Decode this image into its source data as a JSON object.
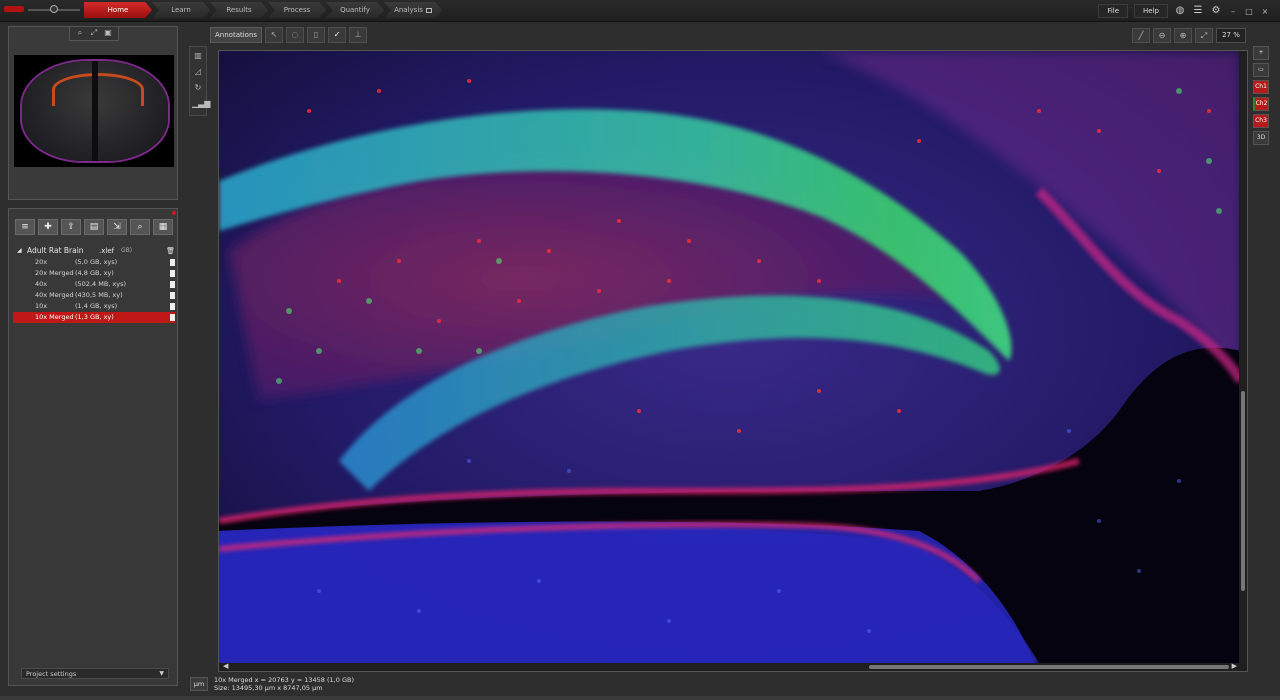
{
  "topbar": {
    "tabs": [
      {
        "label": "Home",
        "active": true
      },
      {
        "label": "Learn"
      },
      {
        "label": "Results"
      },
      {
        "label": "Process"
      },
      {
        "label": "Quantify"
      },
      {
        "label": "Analysis",
        "locked": true
      }
    ],
    "file_label": "File",
    "help_label": "Help",
    "icons": [
      "globe-icon",
      "list-icon",
      "gear-icon"
    ],
    "window_controls": [
      "–",
      "□",
      "×"
    ]
  },
  "navigator": {
    "tools": [
      "zoom-region-icon",
      "fit-icon",
      "overview-toggle-icon"
    ]
  },
  "project": {
    "tool_icons": [
      "add-icon",
      "new-file-icon",
      "import-icon",
      "save-icon",
      "export-icon",
      "search-icon",
      "grid-icon"
    ],
    "root": {
      "name": "Adult Rat Brain",
      "ext": ".xlef",
      "size": "GB)"
    },
    "items": [
      {
        "name": "20x",
        "detail": "(5,0 GB, xys)",
        "selected": false
      },
      {
        "name": "20x Merged",
        "detail": "(4,8 GB, xy)",
        "selected": false
      },
      {
        "name": "40x",
        "detail": "(502,4 MB, xys)",
        "selected": false
      },
      {
        "name": "40x Merged",
        "detail": "(430,5 MB, xy)",
        "selected": false
      },
      {
        "name": "10x",
        "detail": "(1,4 GB, xys)",
        "selected": false
      },
      {
        "name": "10x Merged",
        "detail": "(1,3 GB, xy)",
        "selected": true
      }
    ],
    "settings_label": "Project settings"
  },
  "annotations": {
    "label": "Annotations",
    "tools": [
      "select-icon",
      "lasso-icon",
      "delete-icon",
      "confirm-icon",
      "measure-icon"
    ]
  },
  "view": {
    "zoom_value": "27 %",
    "zoom_tools": [
      "draw-icon",
      "zoom-out-icon",
      "zoom-in-icon",
      "fit-screen-icon"
    ]
  },
  "channels": {
    "top_buttons": [
      "+",
      "▭"
    ],
    "items": [
      "Ch1",
      "Ch2",
      "Ch3"
    ],
    "mode": "3D",
    "colors": {
      "ch1": "#b61b1b",
      "ch2": "#2a8a2a",
      "ch3": "#b61b1b"
    }
  },
  "status": {
    "unit": "µm",
    "line1": "10x Merged   x = 20763  y = 13458  (1,0 GB)",
    "line2": "Size: 13495,30 µm x 8747,05 µm"
  },
  "colors": {
    "accent": "#c01717",
    "background": "#2e2e2e"
  }
}
